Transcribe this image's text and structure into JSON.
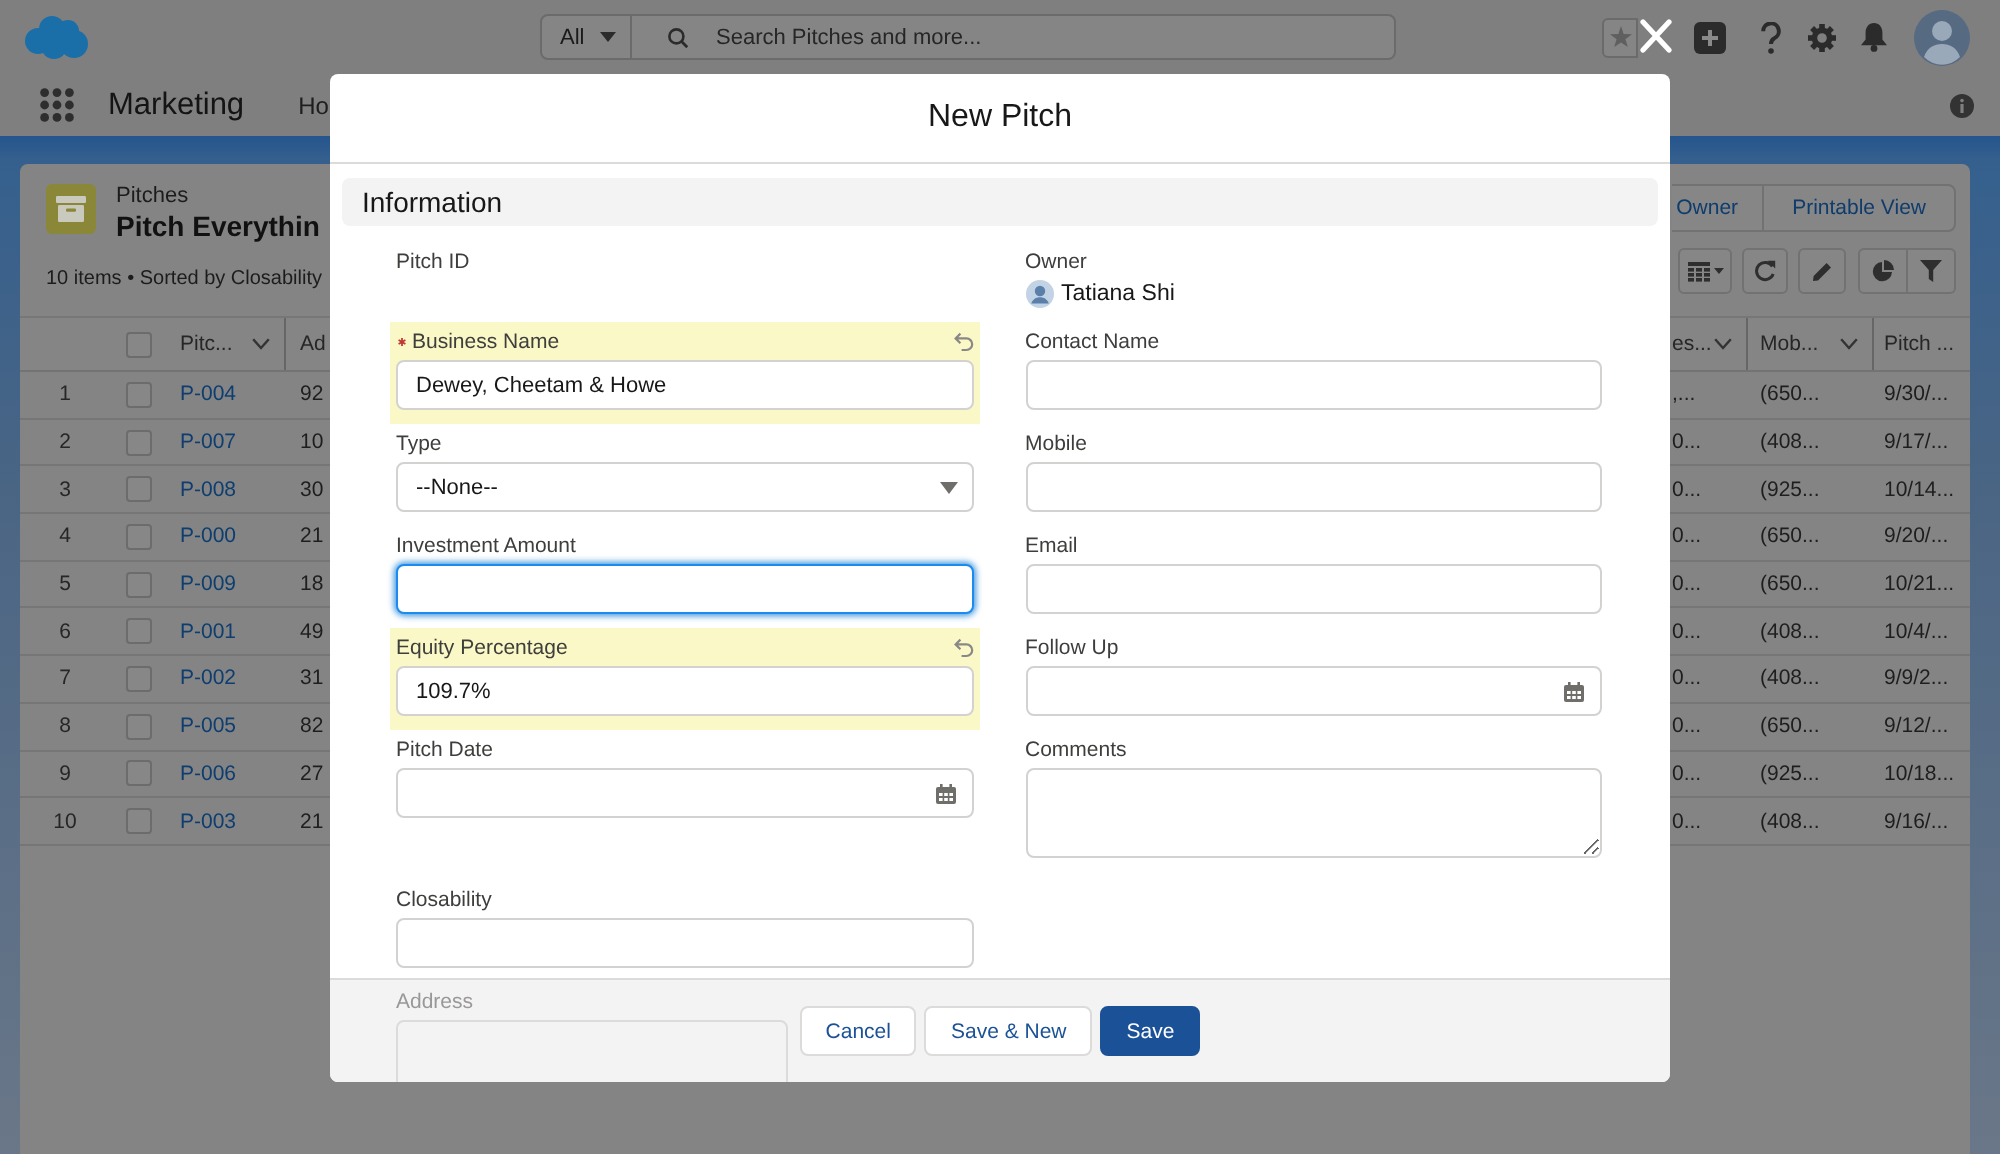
{
  "top_bar": {
    "search_scope": "All",
    "search_placeholder": "Search Pitches and more..."
  },
  "nav_bar": {
    "app_name": "Marketing",
    "items": [
      "Ho"
    ]
  },
  "list_view": {
    "object_name": "Pitches",
    "view_name": "Pitch Everythin",
    "summary": "10 items • Sorted by Closability",
    "buttons": [
      "Owner",
      "Printable View"
    ],
    "table": {
      "select_all_checked": false,
      "columns": [
        {
          "label": "Pitc...",
          "kind": "link",
          "menu": true
        },
        {
          "label": "Ad",
          "kind": "text",
          "menu": false
        },
        {
          "label": "es...",
          "kind": "text",
          "menu": true
        },
        {
          "label": "Mob...",
          "kind": "text",
          "menu": true
        },
        {
          "label": "Pitch ...",
          "kind": "text",
          "menu": false
        }
      ],
      "rows": [
        {
          "number": "1",
          "selected": false,
          "cells": [
            "P-004",
            "92",
            ",...",
            "(650...",
            "9/30/..."
          ]
        },
        {
          "number": "2",
          "selected": false,
          "cells": [
            "P-007",
            "10",
            "0...",
            "(408...",
            "9/17/..."
          ]
        },
        {
          "number": "3",
          "selected": false,
          "cells": [
            "P-008",
            "30",
            "0...",
            "(925...",
            "10/14..."
          ]
        },
        {
          "number": "4",
          "selected": false,
          "cells": [
            "P-000",
            "21",
            "0...",
            "(650...",
            "9/20/..."
          ]
        },
        {
          "number": "5",
          "selected": false,
          "cells": [
            "P-009",
            "18",
            "0...",
            "(650...",
            "10/21..."
          ]
        },
        {
          "number": "6",
          "selected": false,
          "cells": [
            "P-001",
            "49",
            "0...",
            "(408...",
            "10/4/..."
          ]
        },
        {
          "number": "7",
          "selected": false,
          "cells": [
            "P-002",
            "31",
            "0...",
            "(408...",
            "9/9/2..."
          ]
        },
        {
          "number": "8",
          "selected": false,
          "cells": [
            "P-005",
            "82",
            "0...",
            "(650...",
            "9/12/..."
          ]
        },
        {
          "number": "9",
          "selected": false,
          "cells": [
            "P-006",
            "27",
            "0...",
            "(925...",
            "10/18..."
          ]
        },
        {
          "number": "10",
          "selected": false,
          "cells": [
            "P-003",
            "21",
            "0...",
            "(408...",
            "9/16/..."
          ]
        }
      ]
    }
  },
  "modal": {
    "title": "New Pitch",
    "section": {
      "title": "Information",
      "rows": [
        {
          "left": {
            "label": "Pitch ID",
            "kind": "readonly",
            "required": false,
            "changed": false
          },
          "right": {
            "label": "Owner",
            "kind": "user",
            "value": "Tatiana Shi",
            "required": false,
            "changed": false
          }
        },
        {
          "left": {
            "label": "Business Name",
            "kind": "text",
            "value": "Dewey, Cheetam & Howe",
            "required": true,
            "changed": true,
            "focused": false
          },
          "right": {
            "label": "Contact Name",
            "kind": "text",
            "required": false,
            "changed": false,
            "focused": false
          }
        },
        {
          "left": {
            "label": "Type",
            "kind": "picklist",
            "value": "--None--",
            "required": false,
            "changed": false,
            "focused": false
          },
          "right": {
            "label": "Mobile",
            "kind": "text",
            "required": false,
            "changed": false,
            "focused": false
          }
        },
        {
          "left": {
            "label": "Investment Amount",
            "kind": "text",
            "required": false,
            "changed": false,
            "focused": true
          },
          "right": {
            "label": "Email",
            "kind": "text",
            "required": false,
            "changed": false,
            "focused": false
          }
        },
        {
          "left": {
            "label": "Equity Percentage",
            "kind": "text",
            "value": "109.7%",
            "required": false,
            "changed": true,
            "focused": false
          },
          "right": {
            "label": "Follow Up",
            "kind": "date",
            "required": false,
            "changed": false,
            "focused": false
          }
        },
        {
          "left": {
            "label": "Pitch Date",
            "kind": "date",
            "required": false,
            "changed": false,
            "focused": false
          },
          "right": {
            "label": "Comments",
            "kind": "textarea",
            "required": false,
            "changed": false,
            "focused": false
          }
        },
        {
          "left": {
            "label": "Closability",
            "kind": "text",
            "required": false,
            "changed": false,
            "focused": false
          }
        }
      ]
    },
    "obscured_field": {
      "label": "Address"
    },
    "buttons": [
      {
        "label": "Cancel",
        "kind": "neutral"
      },
      {
        "label": "Save & New",
        "kind": "neutral"
      },
      {
        "label": "Save",
        "kind": "brand"
      }
    ]
  }
}
